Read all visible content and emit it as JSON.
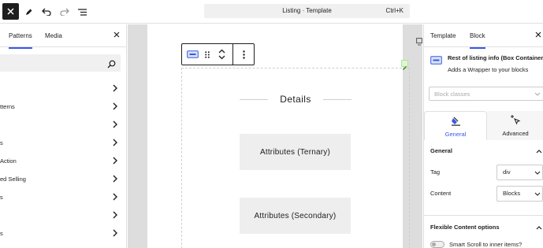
{
  "topbar": {
    "doc_title": "Listing · Template",
    "shortcut": "Ctrl+K"
  },
  "left_panel": {
    "tabs": [
      "Patterns",
      "Media"
    ],
    "active_tab": "Patterns",
    "categories": [
      {
        "label": ""
      },
      {
        "label": "tterns"
      },
      {
        "label": ""
      },
      {
        "label": "s"
      },
      {
        "label": "Action"
      },
      {
        "label": "ed Selling"
      },
      {
        "label": "s"
      },
      {
        "label": ""
      },
      {
        "label": "s"
      }
    ]
  },
  "canvas": {
    "heading": "Details",
    "boxes": [
      "Attributes (Ternary)",
      "Attributes (Secondary)"
    ]
  },
  "right_panel": {
    "tabs": [
      "Template",
      "Block"
    ],
    "active_tab": "Block",
    "block_title": "Rest of listing info (Box Container)",
    "block_description": "Adds a Wrapper to your blocks",
    "classes_placeholder": "Block classes",
    "settings_tabs": [
      "General",
      "Advanced"
    ],
    "general_section": "General",
    "fields": [
      {
        "label": "Tag",
        "value": "div"
      },
      {
        "label": "Content",
        "value": "Blocks"
      }
    ],
    "flex_section": "Flexible Content options",
    "toggle_label": "Smart Scroll to inner items?"
  },
  "colors": {
    "accent": "#3858e9",
    "canvas_bg": "#dddddd",
    "box_bg": "#eeeeee"
  }
}
